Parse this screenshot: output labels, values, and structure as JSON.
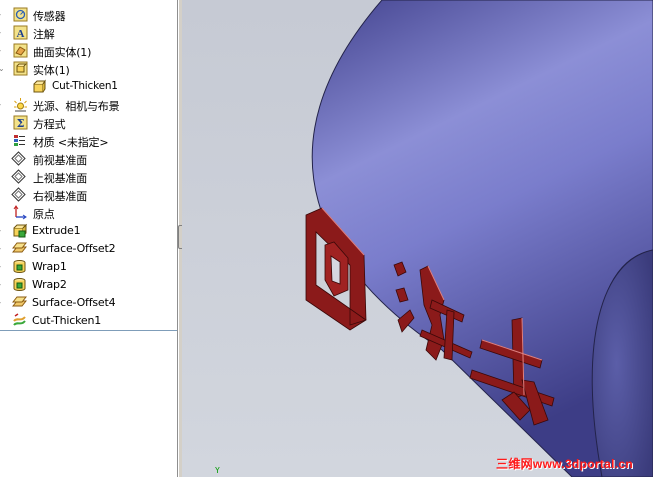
{
  "feature_tree": {
    "items": [
      {
        "label": "传感器",
        "icon": "sensor-icon"
      },
      {
        "label": "注解",
        "icon": "annotation-icon"
      },
      {
        "label": "曲面实体(1)",
        "icon": "surface-bodies-icon"
      },
      {
        "label": "实体(1)",
        "icon": "solid-bodies-icon"
      },
      {
        "label": "Cut-Thicken1",
        "icon": "body-icon"
      },
      {
        "label": "光源、相机与布景",
        "icon": "lights-cameras-icon"
      },
      {
        "label": "方程式",
        "icon": "equations-icon"
      },
      {
        "label": "材质 <未指定>",
        "icon": "material-icon"
      },
      {
        "label": "前视基准面",
        "icon": "plane-icon"
      },
      {
        "label": "上视基准面",
        "icon": "plane-icon"
      },
      {
        "label": "右视基准面",
        "icon": "plane-icon"
      },
      {
        "label": "原点",
        "icon": "origin-icon"
      },
      {
        "label": "Extrude1",
        "icon": "extrude-icon"
      },
      {
        "label": "Surface-Offset2",
        "icon": "surface-offset-icon"
      },
      {
        "label": "Wrap1",
        "icon": "wrap-icon"
      },
      {
        "label": "Wrap2",
        "icon": "wrap-icon"
      },
      {
        "label": "Surface-Offset4",
        "icon": "surface-offset-icon"
      },
      {
        "label": "Cut-Thicken1",
        "icon": "cut-thicken-icon"
      }
    ]
  },
  "viewport": {
    "embossed_text": "回海去",
    "axis_label": "Y",
    "colors": {
      "cylinder": "#5a5aa8",
      "text": "#8b1a1a",
      "background": "#cdd1da"
    }
  },
  "watermark": {
    "text": "三维网www.3dportal.cn"
  }
}
